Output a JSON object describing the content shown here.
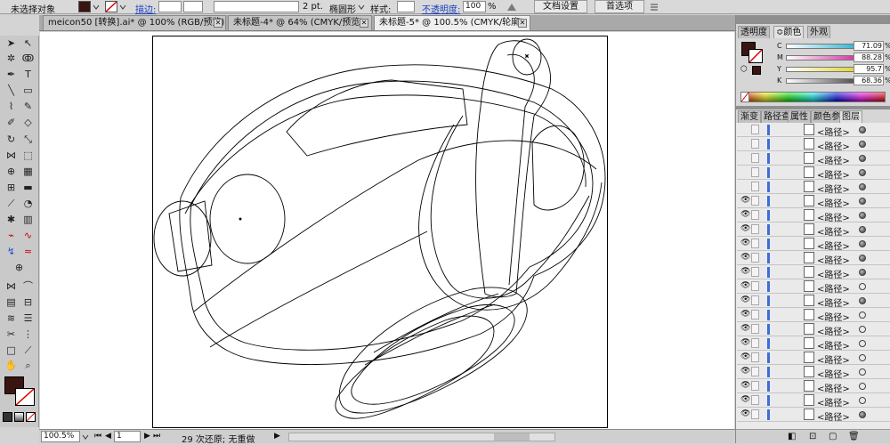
{
  "control_bar": {
    "selection_status": "未选择对象",
    "stroke_label": "描边:",
    "stroke_size": "2 pt.",
    "brush_name": "椭圆形",
    "style_label": "样式:",
    "opacity_label": "不透明度:",
    "opacity_value": "100",
    "opacity_unit": "%",
    "doc_setup_button": "文档设置",
    "preferences_button": "首选项",
    "fill_color": "#3a1410"
  },
  "tabs": [
    {
      "label": "meicon50 [转换].ai* @ 100% (RGB/预览)"
    },
    {
      "label": "未标题-4* @ 64% (CMYK/预览)"
    },
    {
      "label": "未标题-5* @ 100.5% (CMYK/轮廓)"
    }
  ],
  "color_panel": {
    "tabs": [
      "透明度",
      "颜色",
      "外观"
    ],
    "swatch_color": "#3a1410",
    "channels": [
      {
        "label": "C",
        "value": "71.09",
        "color": "#00a0c8"
      },
      {
        "label": "M",
        "value": "88.28",
        "color": "#c8008c"
      },
      {
        "label": "Y",
        "value": "95.7",
        "color": "#d8c800"
      },
      {
        "label": "K",
        "value": "68.36",
        "color": "#202020"
      }
    ],
    "unit": "%"
  },
  "layers_panel": {
    "tabs": [
      "渐变",
      "路径查",
      "属性",
      "颜色参",
      "图层"
    ],
    "items": [
      {
        "name": "<路径>",
        "eye": false,
        "filled": true
      },
      {
        "name": "<路径>",
        "eye": false,
        "filled": true
      },
      {
        "name": "<路径>",
        "eye": false,
        "filled": true
      },
      {
        "name": "<路径>",
        "eye": false,
        "filled": true
      },
      {
        "name": "<路径>",
        "eye": false,
        "filled": true
      },
      {
        "name": "<路径>",
        "eye": true,
        "filled": true
      },
      {
        "name": "<路径>",
        "eye": true,
        "filled": true
      },
      {
        "name": "<路径>",
        "eye": true,
        "filled": true
      },
      {
        "name": "<路径>",
        "eye": true,
        "filled": true
      },
      {
        "name": "<路径>",
        "eye": true,
        "filled": true
      },
      {
        "name": "<路径>",
        "eye": true,
        "filled": true
      },
      {
        "name": "<路径>",
        "eye": true,
        "filled": false
      },
      {
        "name": "<路径>",
        "eye": true,
        "filled": true
      },
      {
        "name": "<路径>",
        "eye": true,
        "filled": false
      },
      {
        "name": "<路径>",
        "eye": true,
        "filled": false
      },
      {
        "name": "<路径>",
        "eye": true,
        "filled": false
      },
      {
        "name": "<路径>",
        "eye": true,
        "filled": false
      },
      {
        "name": "<路径>",
        "eye": true,
        "filled": false
      },
      {
        "name": "<路径>",
        "eye": true,
        "filled": false
      },
      {
        "name": "<路径>",
        "eye": true,
        "filled": false
      },
      {
        "name": "<路径>",
        "eye": true,
        "filled": true
      }
    ]
  },
  "status_bar": {
    "zoom": "100.5%",
    "artboard_number": "1",
    "undo_status": "29 次还原; 无重做"
  }
}
